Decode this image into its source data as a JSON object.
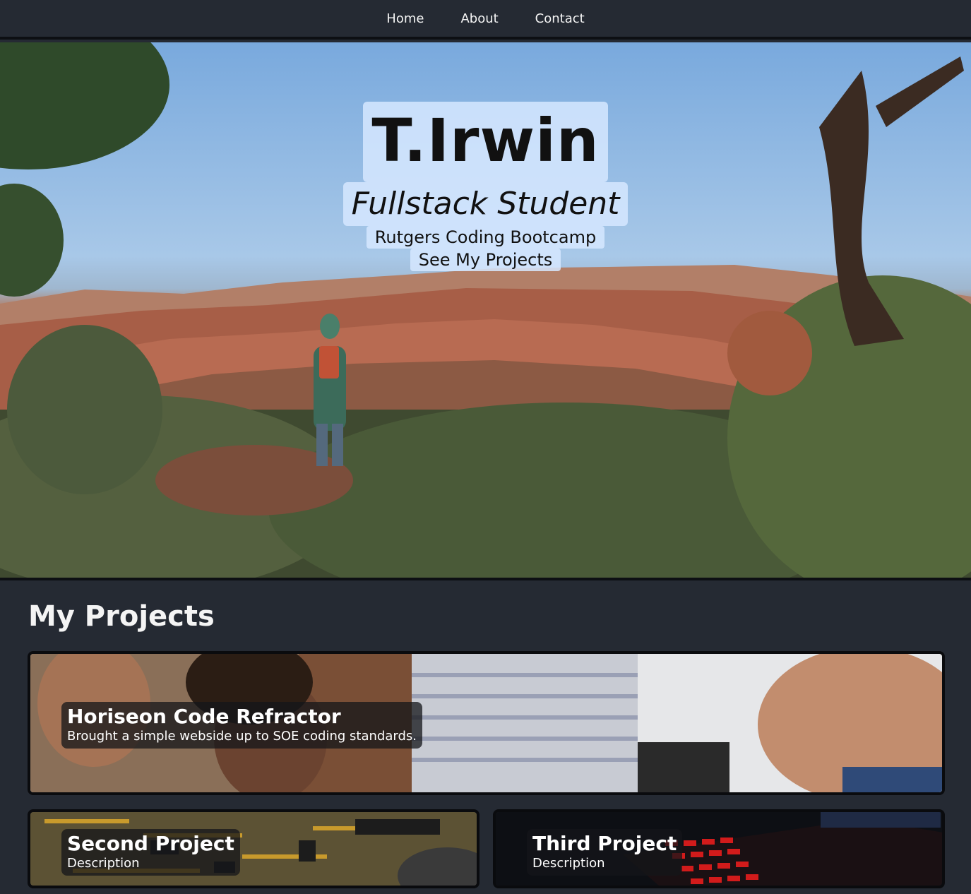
{
  "nav": {
    "items": [
      {
        "label": "Home"
      },
      {
        "label": "About"
      },
      {
        "label": "Contact"
      }
    ]
  },
  "hero": {
    "title": "T.Irwin",
    "subtitle": "Fullstack Student",
    "school": "Rutgers Coding Bootcamp",
    "cta_label": "See My Projects"
  },
  "projects": {
    "section_title": "My Projects",
    "items": [
      {
        "title": "Horiseon Code Refractor",
        "description": "Brought a simple webside up to SOE coding standards."
      },
      {
        "title": "Second Project",
        "description": "Description"
      },
      {
        "title": "Third Project",
        "description": "Description"
      }
    ]
  },
  "colors": {
    "background": "#252a33",
    "nav_text": "#f4f4f4",
    "hero_label_bg": "#d6e8ff",
    "card_border": "#0a0b0e"
  }
}
